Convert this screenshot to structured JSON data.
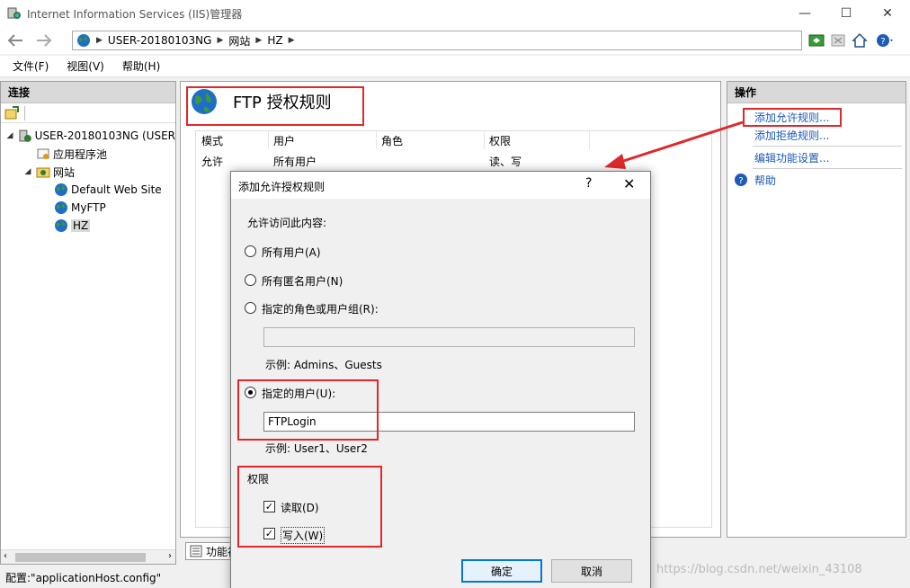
{
  "window": {
    "title": "Internet Information Services (IIS)管理器",
    "min_glyph": "—",
    "max_glyph": "☐",
    "close_glyph": "✕"
  },
  "addressbar": {
    "segments": [
      "USER-20180103NG",
      "网站",
      "HZ"
    ],
    "separator": "▶"
  },
  "menubar": {
    "items": [
      "文件(F)",
      "视图(V)",
      "帮助(H)"
    ]
  },
  "connections": {
    "header": "连接",
    "tree": [
      {
        "label": "USER-20180103NG (USER",
        "toggle": "◢"
      },
      {
        "label": "应用程序池",
        "toggle": ""
      },
      {
        "label": "网站",
        "toggle": "◢"
      },
      {
        "label": "Default Web Site",
        "toggle": ""
      },
      {
        "label": "MyFTP",
        "toggle": ""
      },
      {
        "label": "HZ",
        "toggle": ""
      }
    ]
  },
  "center": {
    "title": "FTP 授权规则",
    "columns": [
      "模式",
      "用户",
      "角色",
      "权限"
    ],
    "rows": [
      [
        "允许",
        "所有用户",
        "",
        "读、写"
      ]
    ],
    "bottom_tab": "功能视"
  },
  "actions": {
    "header": "操作",
    "items": [
      "添加允许规则...",
      "添加拒绝规则...",
      "编辑功能设置...",
      "帮助"
    ]
  },
  "dialog": {
    "title": "添加允许授权规则",
    "help_glyph": "?",
    "close_glyph": "✕",
    "access_label": "允许访问此内容:",
    "option_all_users": "所有用户(A)",
    "option_anonymous": "所有匿名用户(N)",
    "option_roles": "指定的角色或用户组(R):",
    "roles_value": "",
    "roles_example": "示例: Admins、Guests",
    "option_users": "指定的用户(U):",
    "users_value": "FTPLogin",
    "users_example": "示例: User1、User2",
    "permissions_label": "权限",
    "perm_read": "读取(D)",
    "perm_write": "写入(W)",
    "ok": "确定",
    "cancel": "取消"
  },
  "statusbar": {
    "text": "配置:\"applicationHost.config\""
  },
  "watermark": "https://blog.csdn.net/weixin_43108",
  "colors": {
    "callout": "#e0282a",
    "link": "#1a5ab8",
    "accent": "#0078d7"
  }
}
